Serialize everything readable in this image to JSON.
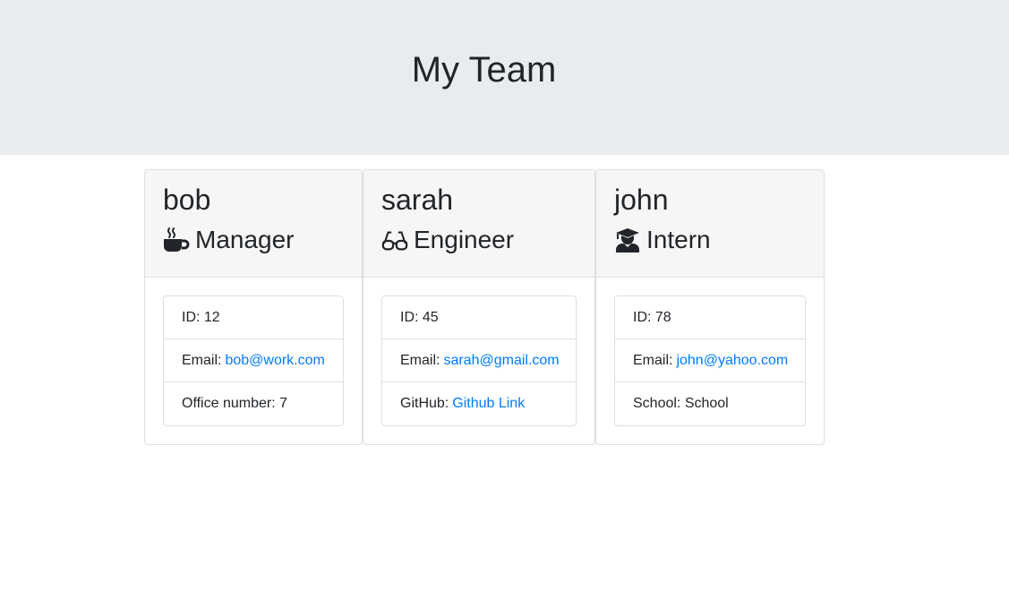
{
  "header": {
    "title": "My Team"
  },
  "team": [
    {
      "name": "bob",
      "role": "Manager",
      "role_icon": "mug-hot-icon",
      "id_label": "ID: 12",
      "email_label": "Email:",
      "email": "bob@work.com",
      "extra_label": "Office number: 7",
      "extra_link": ""
    },
    {
      "name": "sarah",
      "role": "Engineer",
      "role_icon": "glasses-icon",
      "id_label": "ID: 45",
      "email_label": "Email:",
      "email": "sarah@gmail.com",
      "extra_label": "GitHub:",
      "extra_link": "Github Link"
    },
    {
      "name": "john",
      "role": "Intern",
      "role_icon": "graduate-icon",
      "id_label": "ID: 78",
      "email_label": "Email:",
      "email": "john@yahoo.com",
      "extra_label": "School: School",
      "extra_link": ""
    }
  ],
  "colors": {
    "link": "#007bff",
    "header_bg": "#e9ecef",
    "card_header_bg": "#f6f6f6"
  }
}
